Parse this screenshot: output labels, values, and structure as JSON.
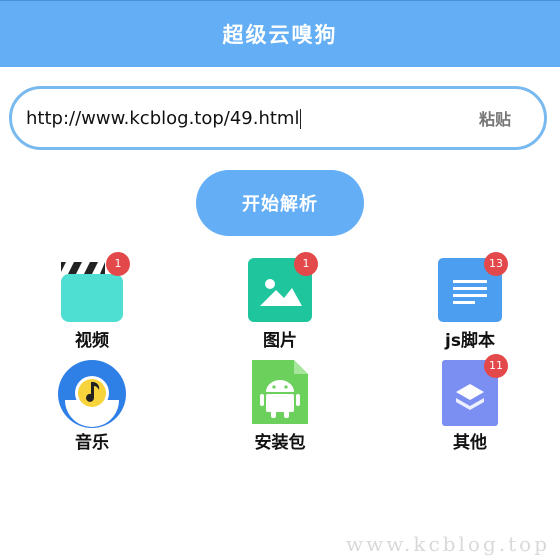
{
  "header": {
    "title": "超级云嗅狗"
  },
  "url_input": {
    "value": "http://www.kcblog.top/49.html",
    "paste_label": "粘贴"
  },
  "start_button": {
    "label": "开始解析"
  },
  "grid": [
    {
      "label": "视频",
      "badge": "1",
      "icon": "video-clapper-icon",
      "color": "#4fdfd2"
    },
    {
      "label": "图片",
      "badge": "1",
      "icon": "image-icon",
      "color": "#1fc59d"
    },
    {
      "label": "js脚本",
      "badge": "13",
      "icon": "document-icon",
      "color": "#4b9ef0"
    },
    {
      "label": "音乐",
      "badge": "",
      "icon": "music-icon",
      "color": "#2e7fe6"
    },
    {
      "label": "安装包",
      "badge": "",
      "icon": "android-apk-icon",
      "color": "#6bd05c"
    },
    {
      "label": "其他",
      "badge": "11",
      "icon": "layers-icon",
      "color": "#7b8ff3"
    }
  ],
  "watermark": "www.kcblog.top"
}
